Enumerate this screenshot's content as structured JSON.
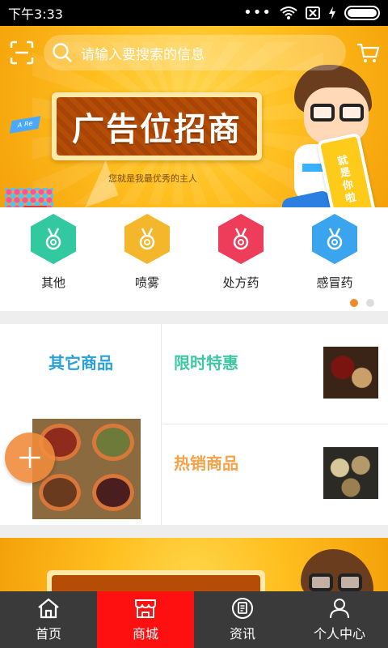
{
  "status_bar": {
    "time": "下午3:33",
    "dots": "•••"
  },
  "banner": {
    "search_placeholder": "请输入要搜索的信息",
    "ad_title": "广告位招商",
    "ad_subtitle": "您就是我最优秀的主人",
    "phone_text": [
      "就",
      "是",
      "你",
      "啦"
    ],
    "plane_text": "A Re"
  },
  "categories": [
    {
      "label": "其他",
      "color": "#33c9a0"
    },
    {
      "label": "喷雾",
      "color": "#f4b62a"
    },
    {
      "label": "处方药",
      "color": "#ee3d5a"
    },
    {
      "label": "感冒药",
      "color": "#3aa4ee"
    }
  ],
  "pager": {
    "count": 2,
    "active_index": 0
  },
  "products": {
    "left_title": "其它商品",
    "top_right_title": "限时特惠",
    "bottom_right_title": "热销商品"
  },
  "nav": [
    {
      "label": "首页",
      "icon": "home-icon",
      "active": false
    },
    {
      "label": "商城",
      "icon": "store-icon",
      "active": true
    },
    {
      "label": "资讯",
      "icon": "news-icon",
      "active": false
    },
    {
      "label": "个人中心",
      "icon": "user-icon",
      "active": false
    }
  ],
  "colors": {
    "accent_red": "#ff1010",
    "banner_yellow": "#ffbf1f",
    "pager_active": "#f08a2a",
    "title_blue": "#2aa0d8",
    "title_green": "#3fc7a4",
    "title_orange": "#f5a24a"
  }
}
